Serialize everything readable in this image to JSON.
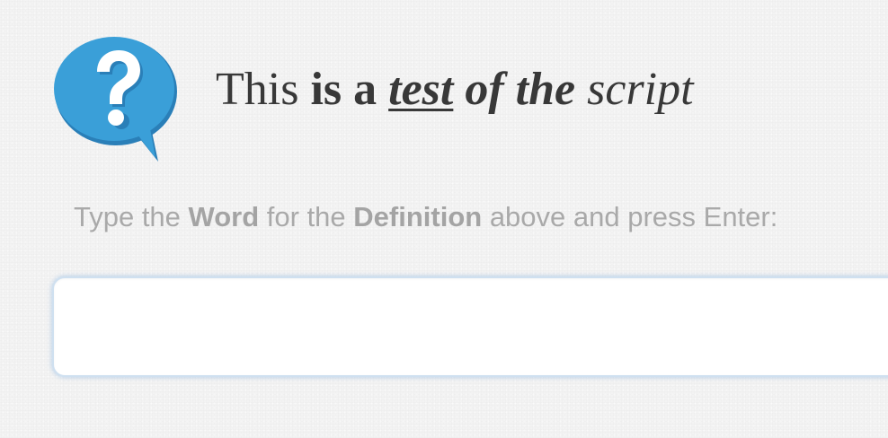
{
  "heading": {
    "part1": "This ",
    "part2": "is a",
    "part3": "test",
    "part4": "of the",
    "part5": "script"
  },
  "instruction": {
    "prefix": "Type the ",
    "word": "Word",
    "middle": " for the ",
    "definition": "Definition",
    "suffix": " above and press Enter:"
  },
  "answer_input": {
    "value": "",
    "placeholder": ""
  },
  "icons": {
    "question": "question-bubble-icon"
  },
  "colors": {
    "icon_blue": "#3a9fd8",
    "icon_shadow": "#2a7fb8",
    "heading_text": "#383838",
    "instruction_text": "#a9a9a9",
    "input_glow": "#78aadc"
  }
}
